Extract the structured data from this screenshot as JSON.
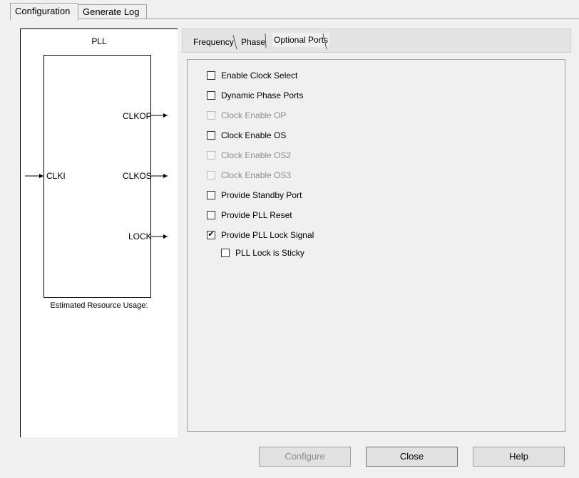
{
  "tabs": {
    "configuration": "Configuration",
    "generate_log": "Generate Log"
  },
  "diagram": {
    "title": "PLL",
    "inputs": {
      "clki": "CLKI"
    },
    "outputs": {
      "clkop": "CLKOP",
      "clkos": "CLKOS",
      "lock": "LOCK"
    },
    "usage_label": "Estimated Resource Usage:"
  },
  "subtabs": {
    "frequency": "Frequency",
    "phase": "Phase",
    "optional_ports": "Optional Ports"
  },
  "options": [
    {
      "label": "Enable Clock Select",
      "checked": false,
      "enabled": true
    },
    {
      "label": "Dynamic Phase Ports",
      "checked": false,
      "enabled": true
    },
    {
      "label": "Clock Enable OP",
      "checked": false,
      "enabled": false
    },
    {
      "label": "Clock Enable OS",
      "checked": false,
      "enabled": true
    },
    {
      "label": "Clock Enable OS2",
      "checked": false,
      "enabled": false
    },
    {
      "label": "Clock Enable OS3",
      "checked": false,
      "enabled": false
    },
    {
      "label": "Provide Standby Port",
      "checked": false,
      "enabled": true
    },
    {
      "label": "Provide PLL Reset",
      "checked": false,
      "enabled": true
    },
    {
      "label": "Provide PLL Lock Signal",
      "checked": true,
      "enabled": true
    },
    {
      "label": "PLL Lock is Sticky",
      "checked": false,
      "enabled": true
    }
  ],
  "check_glyph": "✔",
  "buttons": {
    "configure": "Configure",
    "close": "Close",
    "help": "Help"
  }
}
